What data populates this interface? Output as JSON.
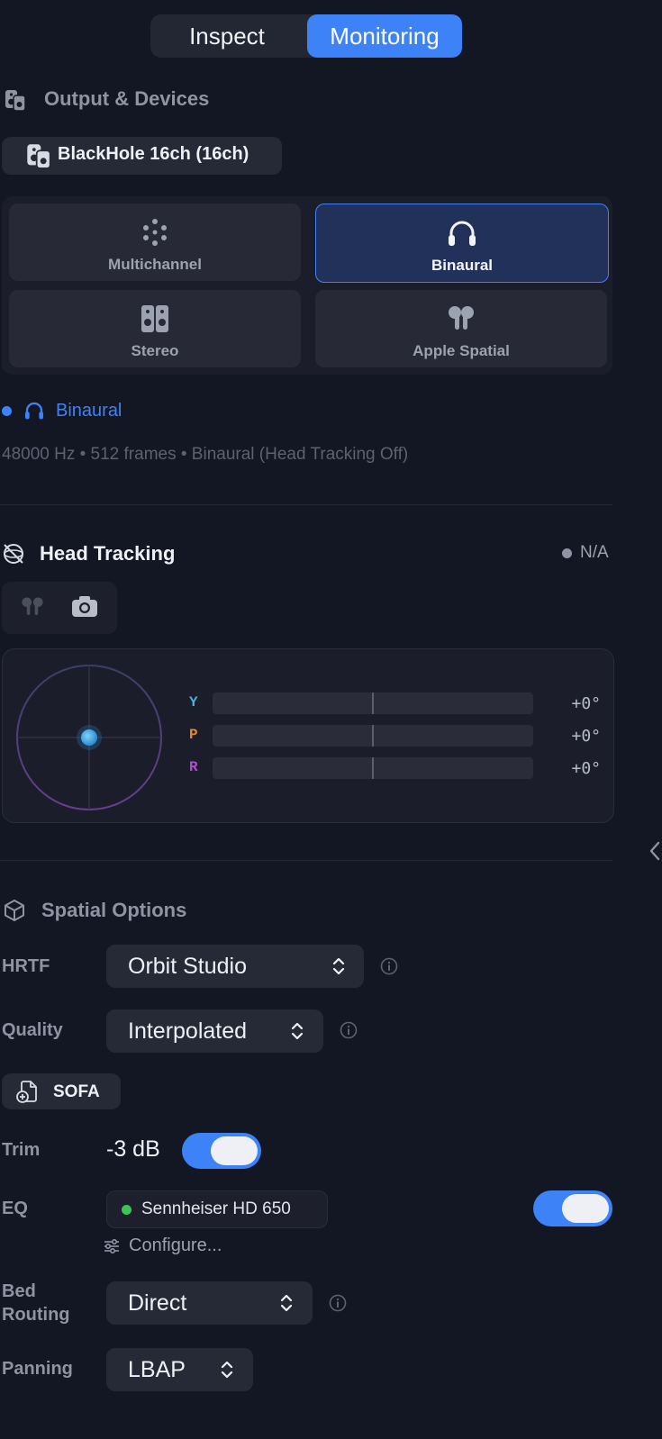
{
  "tabs": [
    {
      "label": "Inspect",
      "active": false
    },
    {
      "label": "Monitoring",
      "active": true
    }
  ],
  "output": {
    "section_title": "Output & Devices",
    "device_name": "BlackHole 16ch (16ch)",
    "modes": [
      {
        "label": "Multichannel",
        "icon": "multichannel-dots-icon",
        "active": false
      },
      {
        "label": "Binaural",
        "icon": "headphones-icon",
        "active": true
      },
      {
        "label": "Stereo",
        "icon": "stereo-speakers-icon",
        "active": false
      },
      {
        "label": "Apple Spatial",
        "icon": "airpods-icon",
        "active": false
      }
    ],
    "current_mode": "Binaural",
    "status_line": "48000 Hz • 512 frames • Binaural (Head Tracking Off)"
  },
  "head_tracking": {
    "title": "Head Tracking",
    "status": "N/A",
    "sources": [
      {
        "icon": "airpods-icon"
      },
      {
        "icon": "camera-icon"
      }
    ],
    "axes": [
      {
        "label": "Y",
        "value": "+0°",
        "color": "#44b4e3"
      },
      {
        "label": "P",
        "value": "+0°",
        "color": "#e0873a"
      },
      {
        "label": "R",
        "value": "+0°",
        "color": "#b34bd6"
      }
    ]
  },
  "spatial": {
    "title": "Spatial Options",
    "hrtf_label": "HRTF",
    "hrtf_value": "Orbit Studio",
    "quality_label": "Quality",
    "quality_value": "Interpolated",
    "sofa_label": "SOFA",
    "trim_label": "Trim",
    "trim_value": "-3 dB",
    "trim_enabled": true,
    "eq_label": "EQ",
    "eq_value": "Sennheiser HD 650",
    "eq_enabled": true,
    "configure_label": "Configure...",
    "bed_routing_label_line1": "Bed",
    "bed_routing_label_line2": "Routing",
    "bed_routing_value": "Direct",
    "panning_label": "Panning",
    "panning_value": "LBAP"
  },
  "colors": {
    "accent": "#3e82f7",
    "background": "#131623",
    "eq_status": "#3cc45a"
  }
}
